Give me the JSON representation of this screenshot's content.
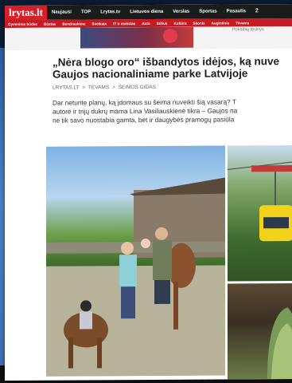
{
  "site": {
    "logo": "lrytas.lt",
    "top_nav": [
      "Naujausi",
      "TOP",
      "Lrytas.tv",
      "Lietuvos diena",
      "Verslas",
      "Sportas",
      "Pasaulis",
      "Ž"
    ],
    "sub_nav": [
      "Gyvenimo būdas",
      "Būstas",
      "Bendraukime",
      "Sveikata",
      "IT ir mokslas",
      "Auto",
      "Stilius",
      "Kultūra",
      "Skonis",
      "Augintinis",
      "Tėvams"
    ]
  },
  "strip_note": "Pokalbių tęsinys",
  "article": {
    "title_line1": "„Nėra blogo oro“ išbandytos idėjos, ką nuve",
    "title_line2": "Gaujos nacionaliniame parke Latvijoje",
    "breadcrumb": [
      "LRYTAS.LT",
      ">",
      "TĖVAMS",
      ">",
      "ŠEIMOS GIDAS"
    ],
    "lead_lines": [
      "Dar neturite planų, ką įdomaus su šeima nuveikti šią vasarą? T",
      "autorė ir trijų dukrų mama Lina Vasiliauskienė tikra – Gaujos na",
      "ne tik savo nuostabia gamta, bet ir daugybės pramogų pasiūla"
    ]
  }
}
